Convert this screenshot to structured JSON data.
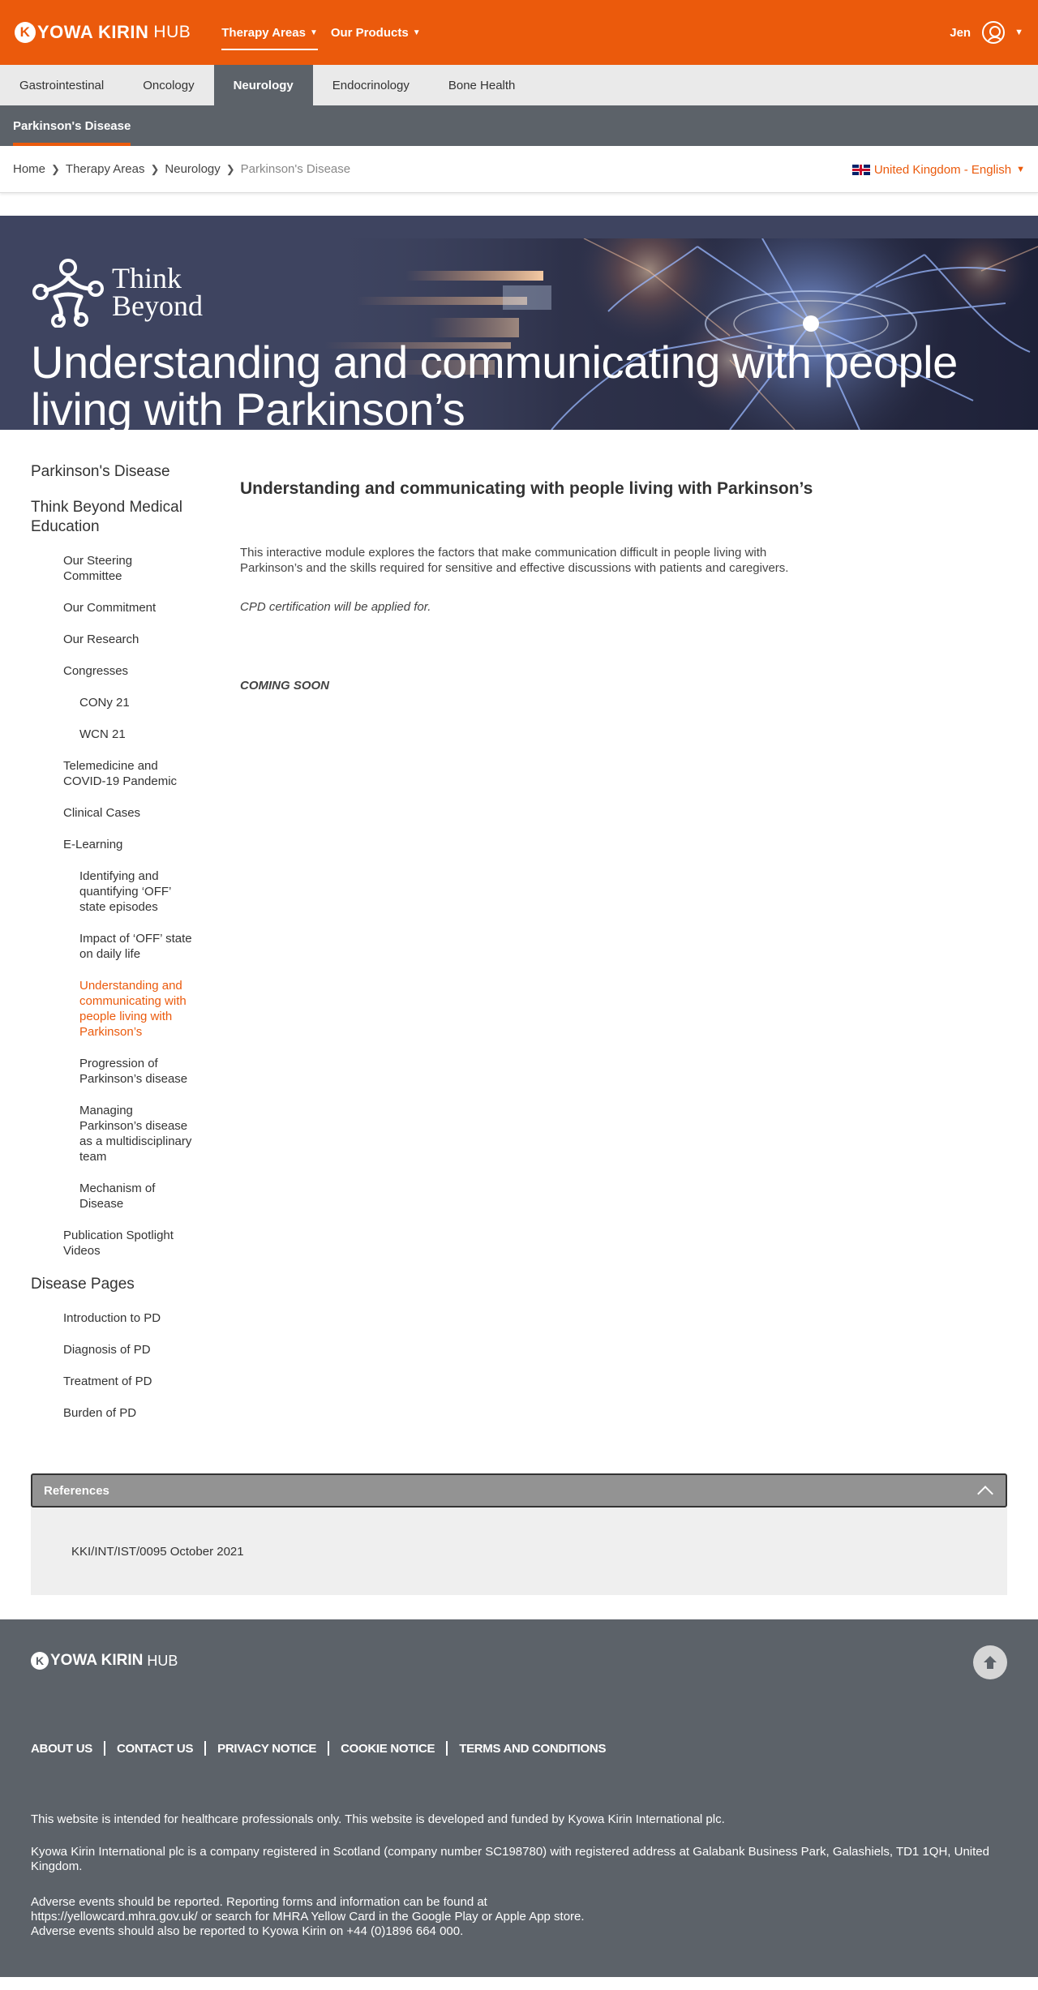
{
  "header": {
    "logo_main": "KYOWA KIRIN",
    "logo_initial": "K",
    "logo_rest": "YOWA KIRIN",
    "logo_hub": "HUB",
    "nav": [
      {
        "label": "Therapy Areas"
      },
      {
        "label": "Our Products"
      }
    ],
    "user_name": "Jen"
  },
  "therapy_tabs": [
    {
      "label": "Gastrointestinal"
    },
    {
      "label": "Oncology"
    },
    {
      "label": "Neurology"
    },
    {
      "label": "Endocrinology"
    },
    {
      "label": "Bone Health"
    }
  ],
  "subnav": {
    "label": "Parkinson's Disease"
  },
  "breadcrumb": [
    {
      "label": "Home"
    },
    {
      "label": "Therapy Areas"
    },
    {
      "label": "Neurology"
    },
    {
      "label": "Parkinson's Disease"
    }
  ],
  "region": {
    "label": "United Kingdom - English"
  },
  "hero": {
    "brand_line1": "Think",
    "brand_line2": "Beyond",
    "title": "Understanding and communicating with people living with Parkinson’s"
  },
  "sidebar": {
    "top": "Parkinson's Disease",
    "section1": "Think Beyond Medical Education",
    "steering": "Our Steering Committee",
    "commitment": "Our Commitment",
    "research": "Our Research",
    "congresses": "Congresses",
    "cony": "CONy 21",
    "wcn": "WCN 21",
    "telemedicine": "Telemedicine and COVID-19 Pandemic",
    "clinical": "Clinical Cases",
    "elearning": "E-Learning",
    "el1": "Identifying and quantifying ‘OFF’ state episodes",
    "el2": "Impact of ‘OFF’ state on daily life",
    "el3": "Understanding and communicating with people living with Parkinson’s",
    "el4": "Progression of Parkinson’s disease",
    "el5": "Managing Parkinson’s disease as a multidisciplinary team",
    "el6": "Mechanism of Disease",
    "publication": "Publication Spotlight Videos",
    "section2": "Disease Pages",
    "dp1": "Introduction to PD",
    "dp2": "Diagnosis of PD",
    "dp3": "Treatment of PD",
    "dp4": "Burden of PD"
  },
  "content": {
    "heading": "Understanding and communicating with people living with Parkinson’s",
    "description": "This interactive module explores the factors that make communication difficult in people living with Parkinson’s and the skills required for sensitive and effective discussions with patients and caregivers.",
    "cpd": "CPD certification will be applied for.",
    "coming_soon": "COMING SOON"
  },
  "references": {
    "title": "References",
    "code": "KKI/INT/IST/0095 October 2021"
  },
  "footer": {
    "links": [
      {
        "label": "ABOUT US"
      },
      {
        "label": "CONTACT US"
      },
      {
        "label": "PRIVACY NOTICE"
      },
      {
        "label": "COOKIE NOTICE"
      },
      {
        "label": "TERMS AND CONDITIONS"
      }
    ],
    "text1": "This website is intended for healthcare professionals only. This website is developed and funded by Kyowa Kirin International plc.",
    "text2": "Kyowa Kirin International plc is a company registered in Scotland (company number SC198780) with registered address at Galabank Business Park, Galashiels, TD1 1QH, United Kingdom.",
    "text3a": "Adverse events should be reported. Reporting forms and information can be found at",
    "text3b": "https://yellowcard.mhra.gov.uk/ or search for MHRA Yellow Card in the Google Play or Apple App store.",
    "text3c": "Adverse events should also be reported to Kyowa Kirin on +44 (0)1896 664 000."
  },
  "colors": {
    "brand_orange": "#eb5a0c",
    "slate": "#5c6269",
    "hero_navy": "#3e4460"
  }
}
